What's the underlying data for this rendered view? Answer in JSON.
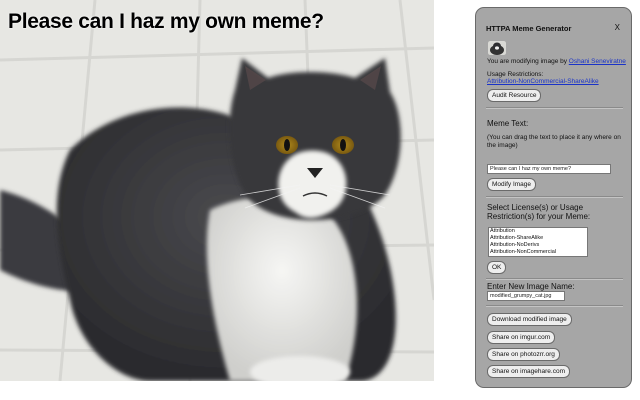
{
  "meme": {
    "text": "Please can I haz my own meme?"
  },
  "panel": {
    "title": "HTTPA Meme Generator",
    "close": "X",
    "modifying_prefix": "You are modifying image by ",
    "author": "Oshani Seneviratne",
    "usage_restrictions_label": "Usage Restrictions:",
    "usage_restrictions_value": "Attribution-NonCommercial-ShareAlike",
    "audit_button": "Audit Resource",
    "meme_text_label": "Meme Text:",
    "meme_text_help": "(You can drag the text to place it any where on the image)",
    "meme_text_value": "Please can I haz my own meme?",
    "modify_button": "Modify Image",
    "license_label": "Select License(s) or Usage Restriction(s) for your Meme:",
    "license_options": [
      "Attribution",
      "Attribution-ShareAlike",
      "Attribution-NoDerivs",
      "Attribution-NonCommercial"
    ],
    "ok_button": "OK",
    "new_name_label": "Enter New Image Name:",
    "new_name_value": "modified_grumpy_cat.jpg",
    "download_button": "Download modified image",
    "share_imgur": "Share on imgur.com",
    "share_photozrr": "Share on photozrr.org",
    "share_imagehare": "Share on imagehare.com"
  },
  "colors": {
    "panel_bg": "#a6a6a6",
    "link": "#1a33c8",
    "tile_floor": "#e6e6e2"
  }
}
